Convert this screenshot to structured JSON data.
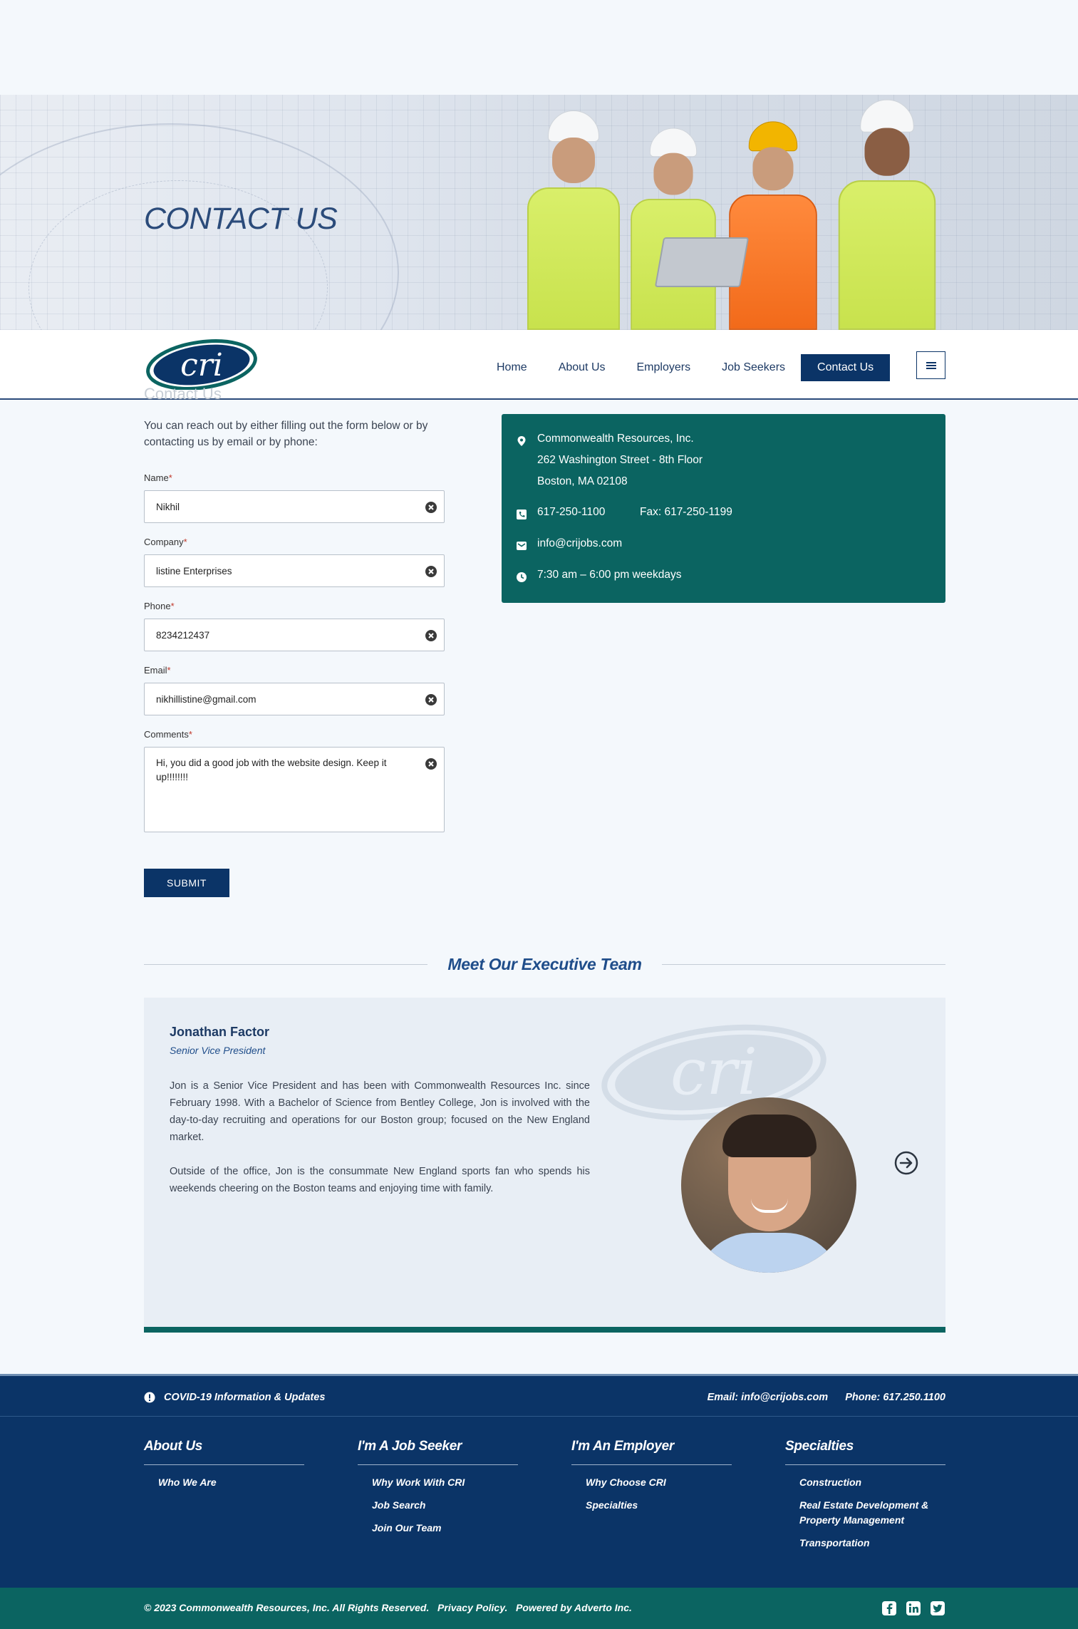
{
  "hero": {
    "title": "CONTACT US"
  },
  "logo": {
    "text": "cri"
  },
  "nav": {
    "items": [
      "Home",
      "About Us",
      "Employers",
      "Job Seekers",
      "Contact Us"
    ],
    "active": "Contact Us"
  },
  "page": {
    "ghost_heading": "Contact Us"
  },
  "form": {
    "intro": "You can reach out by either filling out the form below or by contacting us by email or by phone:",
    "fields": [
      {
        "label": "Name",
        "required": "*",
        "value": "Nikhil"
      },
      {
        "label": "Company",
        "required": "*",
        "value": "listine Enterprises"
      },
      {
        "label": "Phone",
        "required": "*",
        "value": "8234212437"
      },
      {
        "label": "Email",
        "required": "*",
        "value": "nikhillistine@gmail.com"
      },
      {
        "label": "Comments",
        "required": "*",
        "value": "Hi, you did a good job with the website design. Keep it up!!!!!!!!"
      }
    ],
    "submit_label": "SUBMIT"
  },
  "contact_card": {
    "company": "Commonwealth Resources, Inc.",
    "street": "262 Washington Street - 8th Floor",
    "city": "Boston, MA 02108",
    "phone": "617-250-1100",
    "fax": "Fax: 617-250-1199",
    "email": "info@crijobs.com",
    "hours": "7:30 am – 6:00 pm weekdays",
    "bg_color": "#0b6461"
  },
  "team": {
    "heading": "Meet Our Executive Team",
    "member": {
      "name": "Jonathan Factor",
      "title": "Senior Vice President",
      "bio_1": "Jon is a Senior Vice President and has been with Commonwealth Resources Inc. since February 1998. With a Bachelor of Science from Bentley College, Jon is involved with the day-to-day recruiting and operations for our Boston group; focused on the New England market.",
      "bio_2": "Outside of the office, Jon is the consummate New England sports fan who spends his weekends cheering on the Boston teams and enjoying time with family."
    }
  },
  "footer": {
    "covid": "COVID-19 Information & Updates",
    "email": "Email: info@crijobs.com",
    "phone": "Phone: 617.250.1100",
    "columns": [
      {
        "title": "About Us",
        "links": [
          "Who We Are"
        ]
      },
      {
        "title": "I'm A Job Seeker",
        "links": [
          "Why Work With CRI",
          "Job Search",
          "Join Our Team"
        ]
      },
      {
        "title": "I'm An Employer",
        "links": [
          "Why Choose CRI",
          "Specialties"
        ]
      },
      {
        "title": "Specialties",
        "links": [
          "Construction",
          "Real Estate Development & Property Management",
          "Transportation"
        ]
      }
    ],
    "copyright": "© 2023 Commonwealth Resources, Inc. All Rights Reserved.",
    "privacy": "Privacy Policy.",
    "powered": "Powered by Adverto Inc.",
    "socials": [
      "facebook-icon",
      "linkedin-icon",
      "twitter-icon"
    ],
    "primary_color": "#0b3467",
    "accent_color": "#0b6461"
  }
}
